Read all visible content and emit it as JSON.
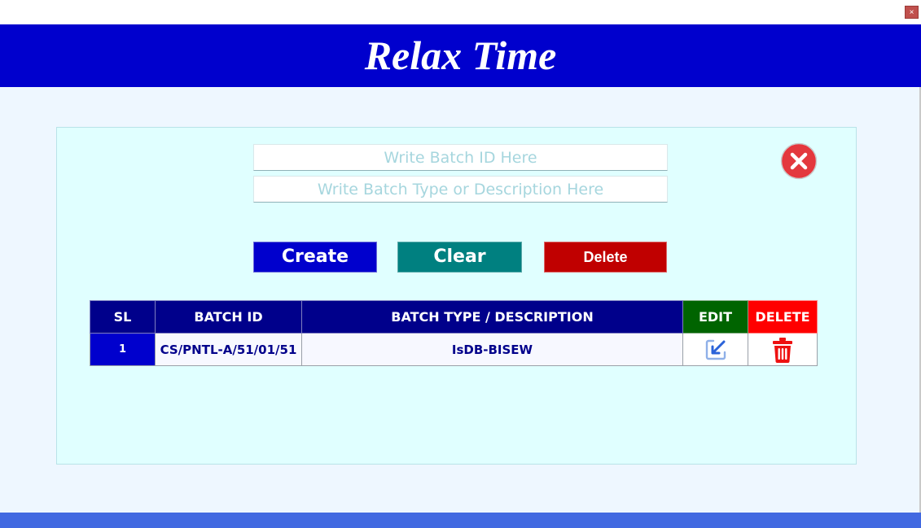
{
  "window": {
    "close_glyph": "×"
  },
  "header": {
    "title": "Relax Time"
  },
  "form": {
    "batch_id_placeholder": "Write Batch ID Here",
    "batch_type_placeholder": "Write Batch Type or Description Here",
    "cancel_icon": "cancel-circle-icon"
  },
  "buttons": {
    "create_label": "Create",
    "clear_label": "Clear",
    "delete_label": "Delete"
  },
  "table": {
    "columns": {
      "sl": "SL",
      "batch_id": "BATCH ID",
      "batch_type": "BATCH TYPE / DESCRIPTION",
      "edit": "EDIT",
      "delete": "DELETE"
    },
    "rows": [
      {
        "sl": "1",
        "batch_id": "CS/PNTL-A/51/01/51",
        "batch_type": "IsDB-BISEW",
        "edit_icon": "edit-arrow-icon",
        "delete_icon": "trash-icon"
      }
    ]
  },
  "colors": {
    "header_bg": "#0000cd",
    "panel_bg": "#e0ffff",
    "create_bg": "#0000cd",
    "clear_bg": "#008080",
    "delete_bg": "#c00000",
    "table_header_bg": "#00008b",
    "edit_header_bg": "#006400",
    "delete_header_bg": "#ff0000",
    "footer_bg": "#4169e1"
  }
}
